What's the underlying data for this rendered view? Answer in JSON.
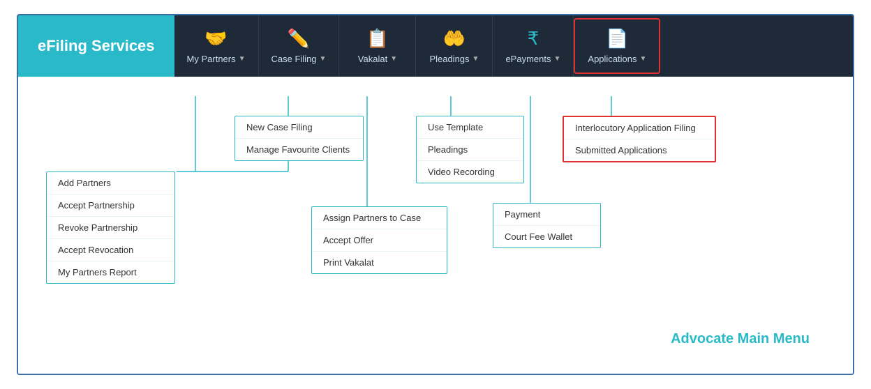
{
  "brand": {
    "label": "eFiling Services"
  },
  "nav": {
    "items": [
      {
        "id": "my-partners",
        "icon": "🤝",
        "label": "My Partners",
        "highlighted": false
      },
      {
        "id": "case-filing",
        "icon": "✏️",
        "label": "Case Filing",
        "highlighted": false
      },
      {
        "id": "vakalat",
        "icon": "📋",
        "label": "Vakalat",
        "highlighted": false
      },
      {
        "id": "pleadings",
        "icon": "🤲",
        "label": "Pleadings",
        "highlighted": false
      },
      {
        "id": "epayments",
        "icon": "₹",
        "label": "ePayments",
        "highlighted": false
      },
      {
        "id": "applications",
        "icon": "📄",
        "label": "Applications",
        "highlighted": true
      }
    ]
  },
  "dropdowns": {
    "case_filing": {
      "items": [
        "New Case Filing",
        "Manage Favourite Clients"
      ]
    },
    "pleadings": {
      "items": [
        "Use Template",
        "Pleadings",
        "Video Recording"
      ]
    },
    "applications": {
      "items": [
        "Interlocutory Application Filing",
        "Submitted Applications"
      ],
      "highlighted_item": 0
    },
    "epayments": {
      "items": [
        "Payment",
        "Court Fee Wallet"
      ]
    },
    "my_partners": {
      "items": [
        "Add Partners",
        "Accept Partnership",
        "Revoke Partnership",
        "Accept Revocation",
        "My Partners Report"
      ]
    },
    "vakalat": {
      "items": [
        "Assign Partners to Case",
        "Accept Offer",
        "Print Vakalat"
      ]
    }
  },
  "footer_label": "Advocate Main Menu"
}
